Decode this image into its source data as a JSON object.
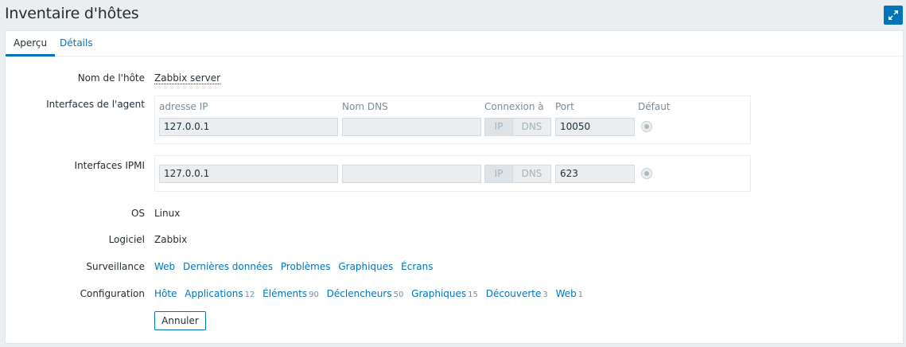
{
  "header": {
    "title": "Inventaire d'hôtes"
  },
  "icons": {
    "fullscreen": "fullscreen-icon"
  },
  "colors": {
    "accent": "#0275b8",
    "background": "#ebeef0"
  },
  "tabs": [
    {
      "label": "Aperçu",
      "active": true
    },
    {
      "label": "Détails",
      "active": false
    }
  ],
  "overview": {
    "hostname_label": "Nom de l'hôte",
    "hostname_value": "Zabbix server",
    "agent_label": "Interfaces de l'agent",
    "columns": {
      "ip": "adresse IP",
      "dns": "Nom DNS",
      "connect": "Connexion à",
      "port": "Port",
      "default": "Défaut"
    },
    "agent": {
      "ip": "127.0.0.1",
      "dns": "",
      "connect_ip": "IP",
      "connect_dns": "DNS",
      "port": "10050"
    },
    "ipmi_label": "Interfaces IPMI",
    "ipmi": {
      "ip": "127.0.0.1",
      "dns": "",
      "connect_ip": "IP",
      "connect_dns": "DNS",
      "port": "623"
    },
    "os_label": "OS",
    "os_value": "Linux",
    "software_label": "Logiciel",
    "software_value": "Zabbix",
    "monitoring_label": "Surveillance",
    "monitoring_links": [
      "Web",
      "Dernières données",
      "Problèmes",
      "Graphiques",
      "Écrans"
    ],
    "config_label": "Configuration",
    "config_links": [
      {
        "label": "Hôte",
        "count": ""
      },
      {
        "label": "Applications",
        "count": "12"
      },
      {
        "label": "Éléments",
        "count": "90"
      },
      {
        "label": "Déclencheurs",
        "count": "50"
      },
      {
        "label": "Graphiques",
        "count": "15"
      },
      {
        "label": "Découverte",
        "count": "3"
      },
      {
        "label": "Web",
        "count": "1"
      }
    ],
    "cancel_label": "Annuler"
  }
}
